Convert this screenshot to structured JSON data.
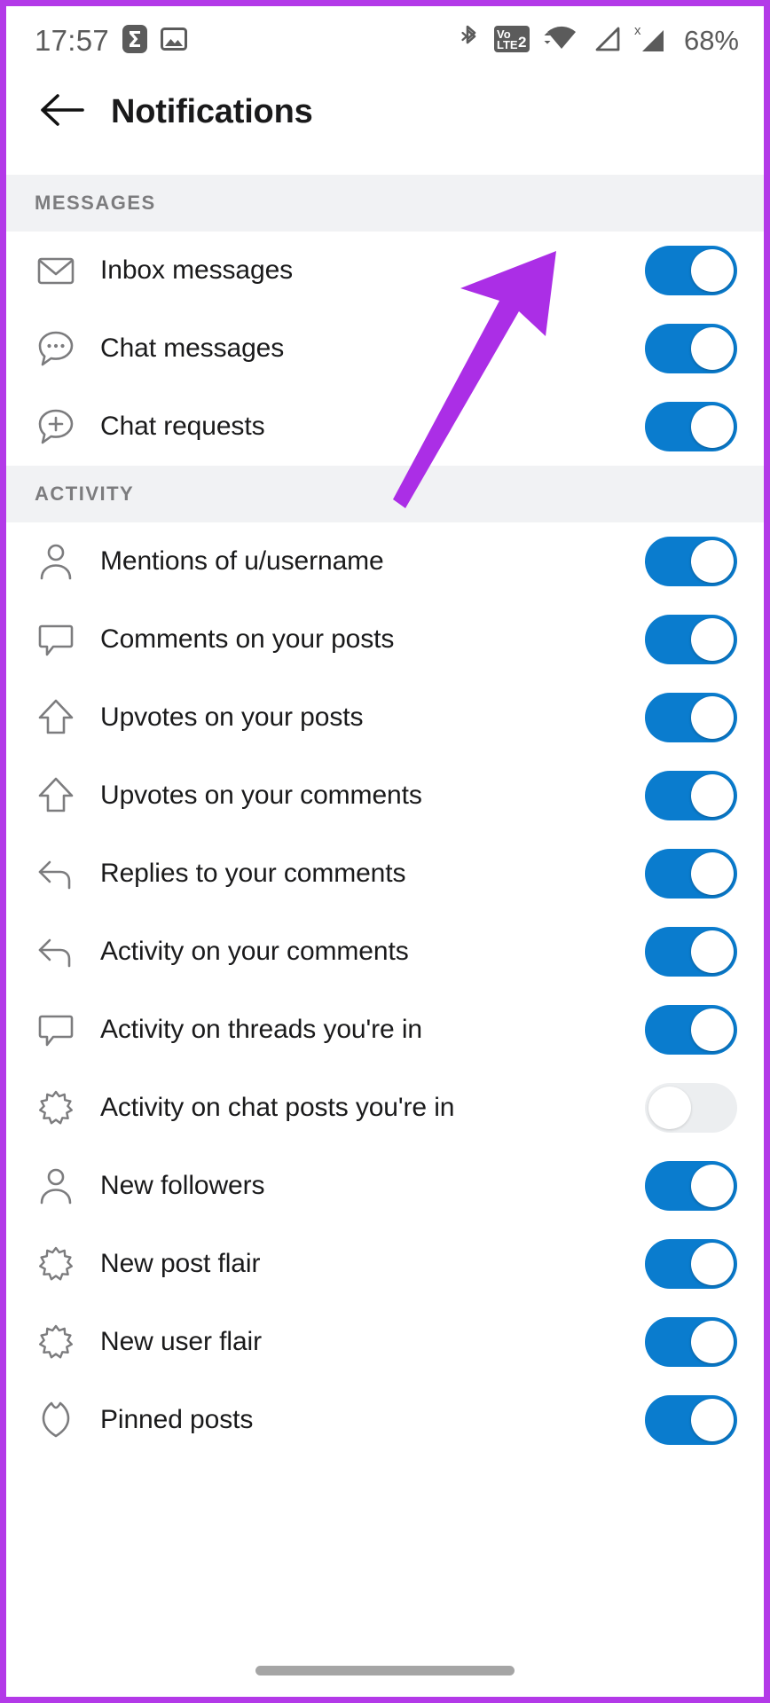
{
  "statusbar": {
    "time": "17:57",
    "battery": "68%",
    "left_icons": [
      "sigma-app-icon",
      "gallery-icon"
    ],
    "right_icons": [
      "bluetooth-icon",
      "volte-2-icon",
      "wifi-icon",
      "sim1-signal-icon",
      "sim2-signal-no-service-icon"
    ]
  },
  "appbar": {
    "back_icon": "back-arrow-icon",
    "title": "Notifications"
  },
  "sections": [
    {
      "header": "MESSAGES",
      "rows": [
        {
          "icon": "envelope-icon",
          "label": "Inbox messages",
          "on": true
        },
        {
          "icon": "chat-bubble-dots-icon",
          "label": "Chat messages",
          "on": true
        },
        {
          "icon": "chat-bubble-plus-icon",
          "label": "Chat requests",
          "on": true
        }
      ]
    },
    {
      "header": "ACTIVITY",
      "rows": [
        {
          "icon": "person-icon",
          "label": "Mentions of u/username",
          "on": true
        },
        {
          "icon": "comment-icon",
          "label": "Comments on your posts",
          "on": true
        },
        {
          "icon": "upvote-arrow-icon",
          "label": "Upvotes on your posts",
          "on": true
        },
        {
          "icon": "upvote-arrow-icon",
          "label": "Upvotes on your comments",
          "on": true
        },
        {
          "icon": "reply-arrow-icon",
          "label": "Replies to your comments",
          "on": true
        },
        {
          "icon": "reply-arrow-icon",
          "label": "Activity on your comments",
          "on": true
        },
        {
          "icon": "comment-icon",
          "label": "Activity on threads you're in",
          "on": true
        },
        {
          "icon": "starburst-icon",
          "label": "Activity on chat posts you're in",
          "on": false
        },
        {
          "icon": "person-icon",
          "label": "New followers",
          "on": true
        },
        {
          "icon": "starburst-icon",
          "label": "New post flair",
          "on": true
        },
        {
          "icon": "starburst-icon",
          "label": "New user flair",
          "on": true
        },
        {
          "icon": "pin-icon",
          "label": "Pinned posts",
          "on": true
        }
      ]
    }
  ],
  "annotation": {
    "type": "arrow",
    "color": "#ab2ee6",
    "points_to": "Inbox messages toggle"
  },
  "colors": {
    "accent_on": "#0a7cce",
    "toggle_off": "#eceef0",
    "section_bg": "#f1f2f4",
    "frame": "#b339e8"
  }
}
